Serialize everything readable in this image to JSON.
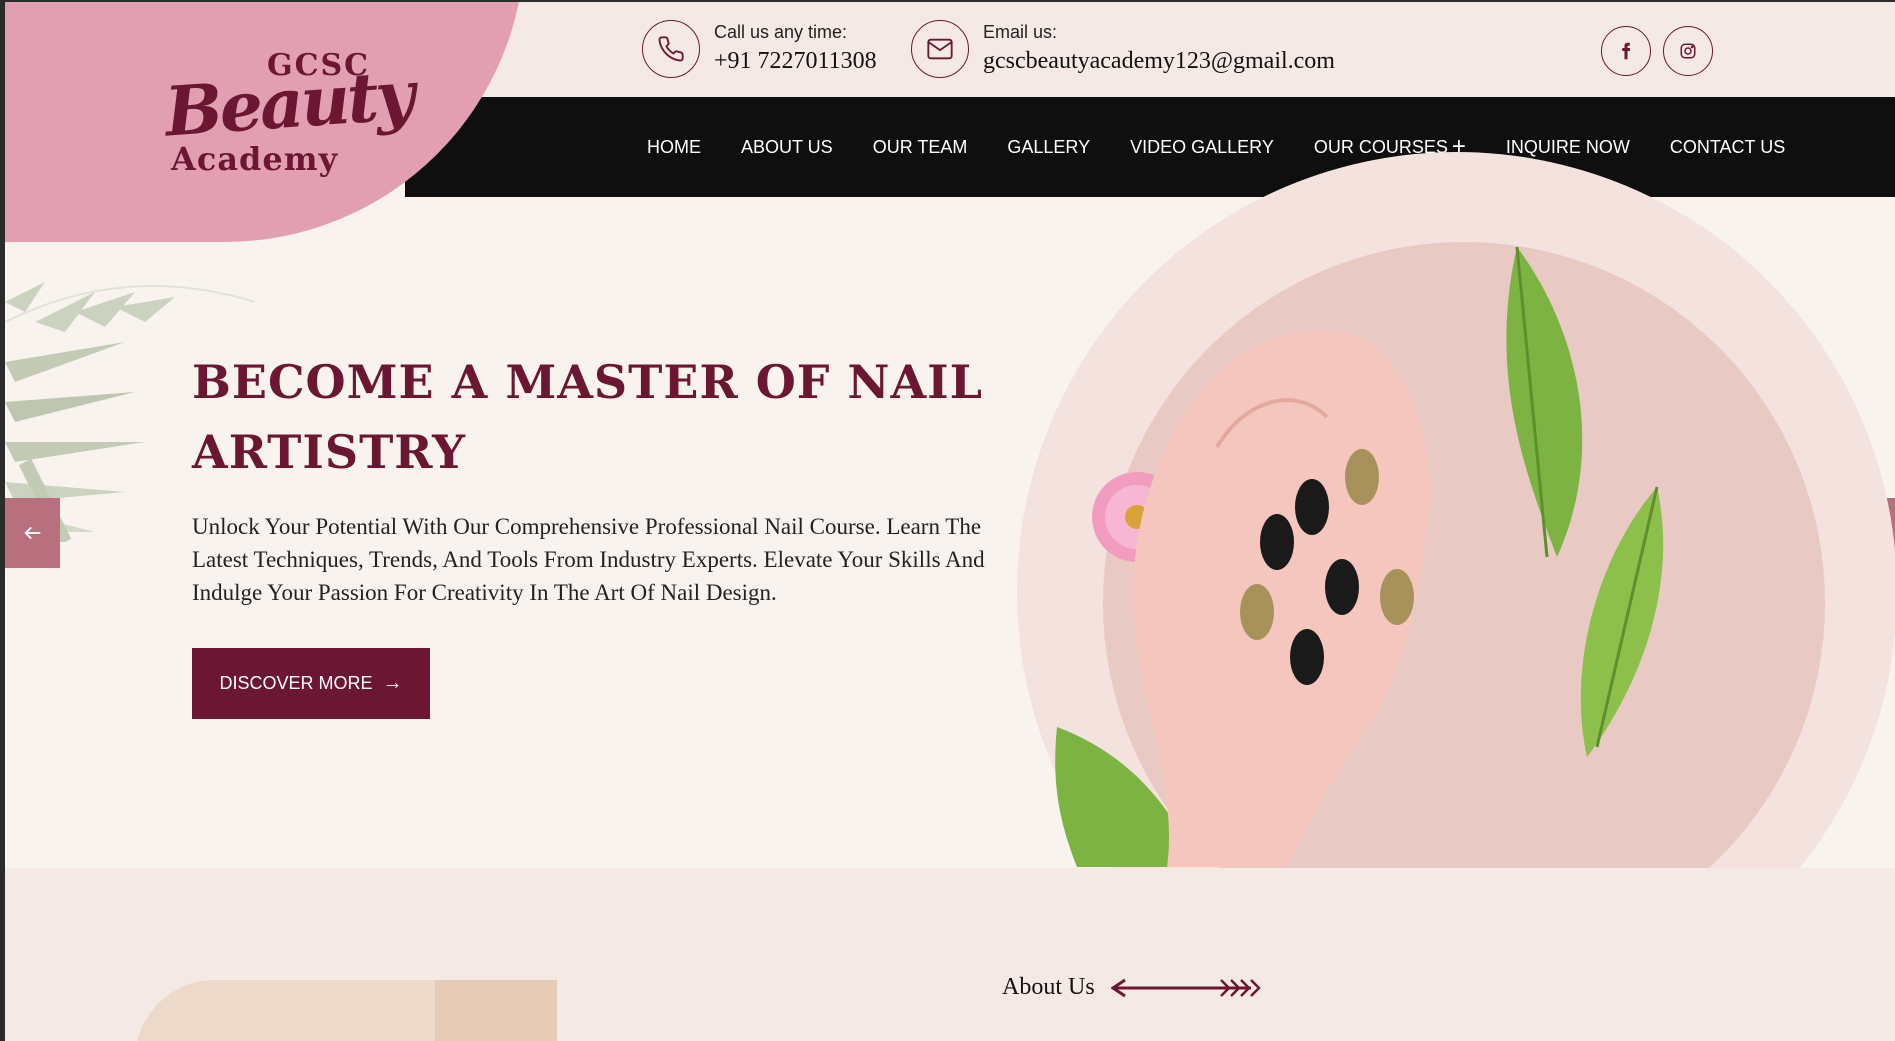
{
  "brand": {
    "line1": "GCSC",
    "line2": "Beauty",
    "line3": "Academy"
  },
  "contact": {
    "phone_label": "Call us any time:",
    "phone_value": "+91 7227011308",
    "email_label": "Email us:",
    "email_value": "gcscbeautyacademy123@gmail.com"
  },
  "social": [
    "facebook-icon",
    "instagram-icon"
  ],
  "nav": [
    "HOME",
    "ABOUT US",
    "OUR TEAM",
    "GALLERY",
    "VIDEO GALLERY",
    "OUR COURSES",
    "INQUIRE NOW",
    "CONTACT US"
  ],
  "hero": {
    "title_line1": "BECOME A MASTER OF NAIL",
    "title_line2": "ARTISTRY",
    "text": "Unlock Your Potential With Our Comprehensive Professional Nail Course. Learn The Latest Techniques, Trends, And Tools From Industry Experts. Elevate Your Skills And Indulge Your Passion For Creativity In The Art Of Nail Design.",
    "cta": "DISCOVER MORE"
  },
  "about": {
    "heading": "About Us"
  },
  "colors": {
    "accent": "#6b1733",
    "pink": "#e29fb1",
    "nav_bg": "#0f0f0f",
    "bg": "#f9f3f0"
  }
}
